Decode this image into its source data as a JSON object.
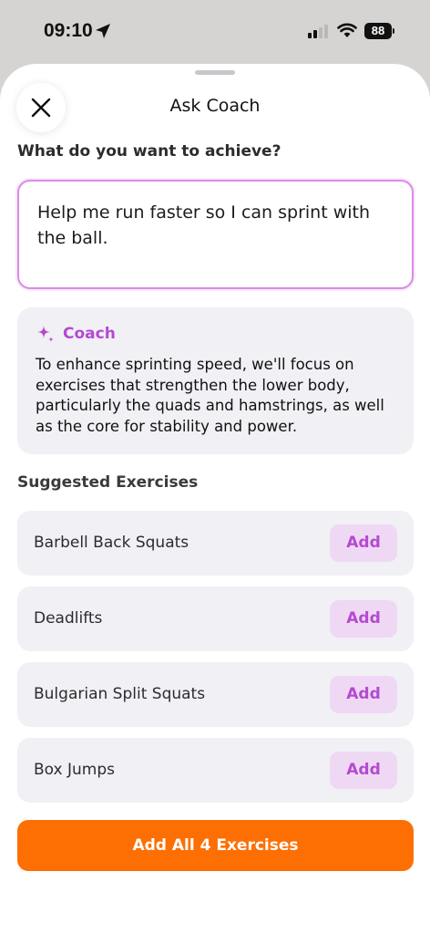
{
  "status_bar": {
    "time": "09:10",
    "battery": "88"
  },
  "sheet": {
    "title": "Ask Coach",
    "question": "What do you want to achieve?",
    "goal_text": "Help me run faster so I can sprint with the ball."
  },
  "coach": {
    "name": "Coach",
    "message": "To enhance sprinting speed, we'll focus on exercises that strengthen the lower body, particularly the quads and hamstrings, as well as the core for stability and power."
  },
  "suggestions": {
    "title": "Suggested Exercises",
    "exercises": [
      {
        "name": "Barbell Back Squats",
        "button": "Add"
      },
      {
        "name": "Deadlifts",
        "button": "Add"
      },
      {
        "name": "Bulgarian Split Squats",
        "button": "Add"
      },
      {
        "name": "Box Jumps",
        "button": "Add"
      }
    ],
    "add_all_label": "Add All 4 Exercises"
  },
  "colors": {
    "accent_purple": "#b44ad0",
    "add_button_bg": "#efd8f4",
    "primary_orange": "#fd6f02",
    "card_bg": "#f1f0f5"
  },
  "icons": {
    "location": "location-arrow-icon",
    "signal": "cellular-signal-icon",
    "wifi": "wifi-icon",
    "close": "close-icon",
    "coach": "sparkle-icon"
  }
}
